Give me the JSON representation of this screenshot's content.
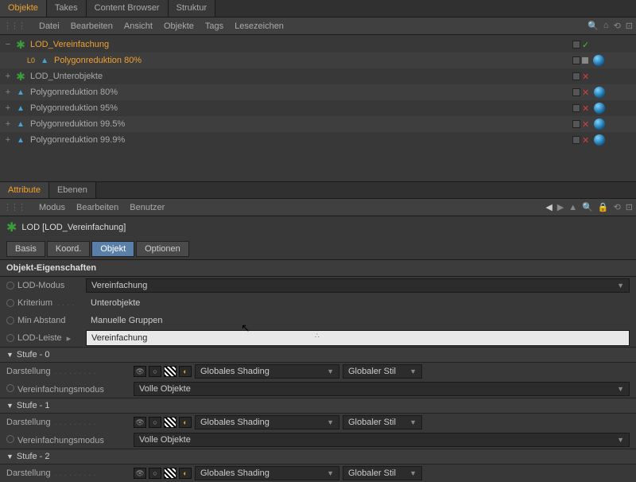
{
  "top_tabs": [
    "Objekte",
    "Takes",
    "Content Browser",
    "Struktur"
  ],
  "obj_menu": [
    "Datei",
    "Bearbeiten",
    "Ansicht",
    "Objekte",
    "Tags",
    "Lesezeichen"
  ],
  "tree": [
    {
      "name": "LOD_Vereinfachung",
      "sel": true,
      "icon": "leaf",
      "indent": 0,
      "exp": "−",
      "tags": [
        "box",
        "check"
      ]
    },
    {
      "name": "Polygonreduktion 80%",
      "sel": true,
      "icon": "tri",
      "indent": 1,
      "pre": "L0",
      "exp": "",
      "tags": [
        "box",
        "layer",
        "sphere"
      ]
    },
    {
      "name": "LOD_Unterobjekte",
      "sel": false,
      "icon": "leaf",
      "indent": 0,
      "exp": "+",
      "tags": [
        "box",
        "x"
      ]
    },
    {
      "name": "Polygonreduktion 80%",
      "sel": false,
      "icon": "tri",
      "indent": 0,
      "exp": "+",
      "tags": [
        "box",
        "x",
        "sphere"
      ]
    },
    {
      "name": "Polygonreduktion 95%",
      "sel": false,
      "icon": "tri",
      "indent": 0,
      "exp": "+",
      "tags": [
        "box",
        "x",
        "sphere"
      ]
    },
    {
      "name": "Polygonreduktion 99.5%",
      "sel": false,
      "icon": "tri",
      "indent": 0,
      "exp": "+",
      "tags": [
        "box",
        "x",
        "sphere"
      ]
    },
    {
      "name": "Polygonreduktion 99.9%",
      "sel": false,
      "icon": "tri",
      "indent": 0,
      "exp": "+",
      "tags": [
        "box",
        "x",
        "sphere"
      ]
    }
  ],
  "panel_tabs": [
    "Attribute",
    "Ebenen"
  ],
  "attr_menu": [
    "Modus",
    "Bearbeiten",
    "Benutzer"
  ],
  "attr_title": "LOD [LOD_Vereinfachung]",
  "sub_tabs": [
    "Basis",
    "Koord.",
    "Objekt",
    "Optionen"
  ],
  "prop_section_title": "Objekt-Eigenschaften",
  "props": {
    "lod_modus_label": "LOD-Modus",
    "lod_modus_value": "Vereinfachung",
    "kriterium_label": "Kriterium",
    "kriterium_value": "Unterobjekte",
    "min_abstand_label": "Min Abstand",
    "min_abstand_value": "Manuelle Gruppen",
    "lod_leiste_label": "LOD-Leiste",
    "lod_leiste_value": "Vereinfachung"
  },
  "stufen": [
    {
      "title": "Stufe - 0"
    },
    {
      "title": "Stufe - 1"
    },
    {
      "title": "Stufe - 2"
    }
  ],
  "stufe_labels": {
    "darstellung": "Darstellung",
    "vereinfachungsmodus": "Vereinfachungsmodus",
    "shading": "Globales Shading",
    "stil": "Globaler Stil",
    "volle": "Volle Objekte"
  }
}
